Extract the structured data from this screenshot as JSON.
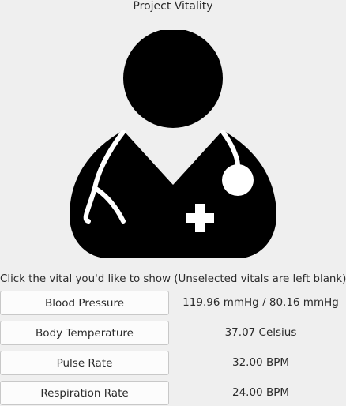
{
  "app": {
    "title": "Project Vitality"
  },
  "illustration": {
    "icon": "doctor-icon",
    "color": "#000000"
  },
  "hint": "Click the vital you'd like to show (Unselected vitals are left blank)...",
  "vitals": [
    {
      "label": "Blood Pressure",
      "value": "119.96 mmHg / 80.16 mmHg"
    },
    {
      "label": "Body Temperature",
      "value": "37.07 Celsius"
    },
    {
      "label": "Pulse Rate",
      "value": "32.00 BPM"
    },
    {
      "label": "Respiration Rate",
      "value": "24.00 BPM"
    }
  ]
}
